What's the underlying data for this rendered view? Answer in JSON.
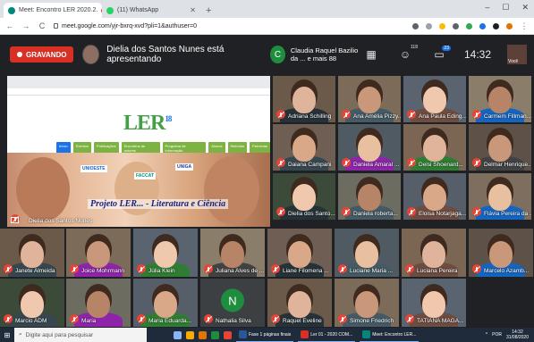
{
  "browser": {
    "tabs": [
      {
        "label": "Meet: Encontro LER 2020.2.",
        "active": true
      },
      {
        "label": "(11) WhatsApp",
        "active": false
      }
    ],
    "new_tab": "+",
    "url": "meet.google.com/yjr-bxrq-xvd?pli=1&authuser=0",
    "window_controls": [
      "–",
      "☐",
      "✕"
    ]
  },
  "meet_bar": {
    "recording_label": "GRAVANDO",
    "presenting_text": "Dielia dos Santos Nunes está apresentando",
    "owner_initial": "C",
    "owner_text": "Claudia Raquel Bazilio da ... e mais 88",
    "participants_count": "118",
    "chat_count": "23",
    "time": "14:32",
    "self_label": "Você"
  },
  "presentation": {
    "logo": "LER",
    "logo_superscript": "18",
    "menu": [
      "Início",
      "Eventos",
      "Publicações",
      "Encontros de autores",
      "Programa de informação",
      "Alunos",
      "Histórias",
      "Parcerias"
    ],
    "banner_text": "Projeto LER... - Literatura e Ciência",
    "logos": [
      "UNIOESTE",
      "FACCAT",
      "UNIGA"
    ]
  },
  "participants": [
    {
      "name": "Adriana Schilling"
    },
    {
      "name": "Ana Amélia Pizzy..."
    },
    {
      "name": "Ana Paula Eding..."
    },
    {
      "name": "Carmem Fillman..."
    },
    {
      "name": "Daiana Campani"
    },
    {
      "name": "Daniela Amaral ..."
    },
    {
      "name": "Deisi Shoenard..."
    },
    {
      "name": "Delmar Henrique..."
    },
    {
      "name": "Dielia dos Santo..."
    },
    {
      "name": "Daniela roberta..."
    },
    {
      "name": "Eloisa Notarjaga..."
    },
    {
      "name": "Flávia Pereira da ..."
    },
    {
      "name": "Janete Almeida"
    },
    {
      "name": "Joice Mohrmann"
    },
    {
      "name": "Júlia Klein"
    },
    {
      "name": "Juliana Alves de ..."
    },
    {
      "name": "Liane Filomena ..."
    },
    {
      "name": "Luciane Maria ..."
    },
    {
      "name": "Luciana Pereira"
    },
    {
      "name": "Marcelo Azamb..."
    },
    {
      "name": "Marcio ADM"
    },
    {
      "name": "Maria"
    },
    {
      "name": "Maria Eduarda..."
    },
    {
      "name": "Nathalia Silva",
      "initial": "N"
    },
    {
      "name": "Raquel Eveline"
    },
    {
      "name": "Simone Friedrich"
    },
    {
      "name": "TATIANA MAGA..."
    }
  ],
  "presenter_tile_name": "Dielia dos Santos Nunes",
  "taskbar": {
    "search_placeholder": "Digite aqui para pesquisar",
    "apps": [
      "Fase 1 páginas finais",
      "Ler 01 - 2020 COM...",
      "Meet: Encontro LER..."
    ],
    "lang": "POR",
    "time": "14:32",
    "date": "31/08/2020"
  }
}
